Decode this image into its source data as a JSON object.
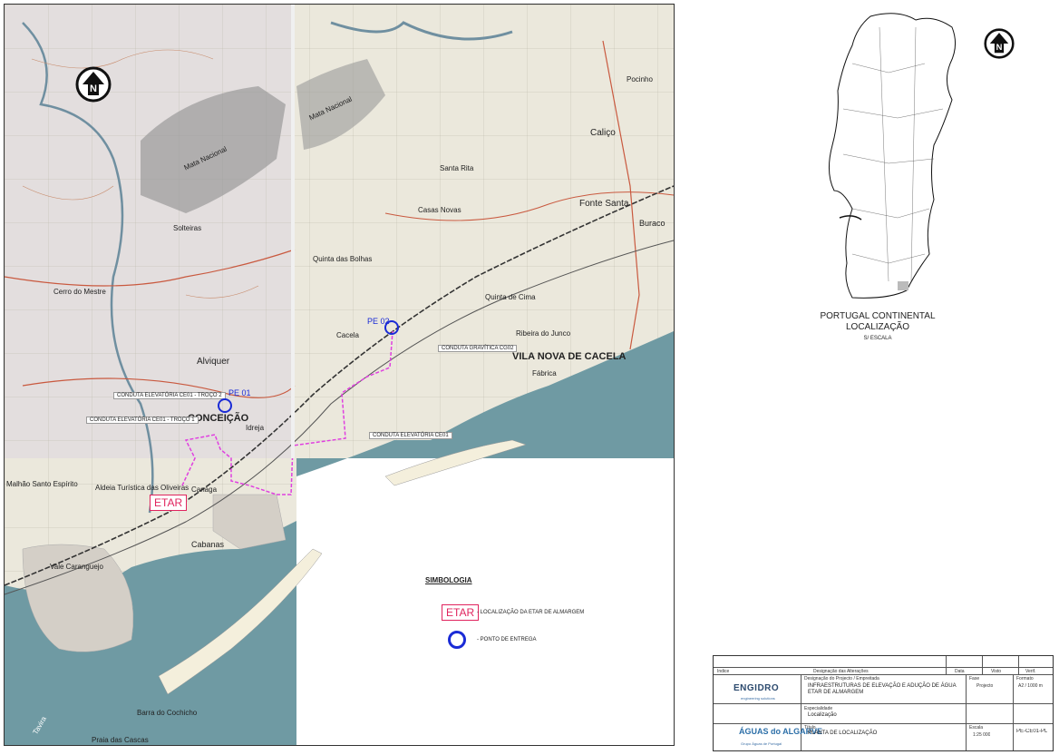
{
  "map": {
    "places": [
      {
        "id": "concei",
        "text": "CONCEIÇÃO",
        "big": true
      },
      {
        "id": "idreja",
        "text": "Idreja"
      },
      {
        "id": "alviq",
        "text": "Alviquer"
      },
      {
        "id": "vnc",
        "text": "VILA NOVA DE CACELA",
        "big": true
      },
      {
        "id": "cabanas",
        "text": "Cabanas"
      },
      {
        "id": "cacela",
        "text": "Cacela"
      },
      {
        "id": "santarita",
        "text": "Santa Rita"
      },
      {
        "id": "calico",
        "text": "Caliço"
      },
      {
        "id": "pocinho",
        "text": "Pocinho"
      },
      {
        "id": "fontesanta",
        "text": "Fonte Santa"
      },
      {
        "id": "buraco",
        "text": "Buraco"
      },
      {
        "id": "solteiras",
        "text": "Solteiras"
      },
      {
        "id": "malhasanto",
        "text": "Malhão Santo Espírito"
      },
      {
        "id": "aldeiatur",
        "text": "Aldeia Turística das Oliveiras"
      },
      {
        "id": "canaga",
        "text": "Canaga"
      },
      {
        "id": "valecaranguejo",
        "text": "Vale Caranguejo"
      },
      {
        "id": "matanac1",
        "text": "Mata Nacional"
      },
      {
        "id": "matanac2",
        "text": "Mata Nacional"
      },
      {
        "id": "quintacima",
        "text": "Quinta de Cima"
      },
      {
        "id": "ribeiraj",
        "text": "Ribeira do Junco"
      },
      {
        "id": "fabrica",
        "text": "Fábrica"
      },
      {
        "id": "lacaminho",
        "text": "Cerro do Mestre"
      },
      {
        "id": "casasnovas",
        "text": "Casas Novas"
      },
      {
        "id": "quintabolas",
        "text": "Quinta das Bolhas"
      },
      {
        "id": "barracochicho",
        "text": "Barra do Cochicho"
      },
      {
        "id": "praiacascas",
        "text": "Praia das Cascas"
      },
      {
        "id": "tavira",
        "text": "Tavira"
      }
    ],
    "conduits": [
      {
        "id": "c1",
        "text": "CONDUTA ELEVATÓRIA CE01 - TROÇO 2"
      },
      {
        "id": "c2",
        "text": "CONDUTA ELEVATÓRIA CE01 - TROÇO 1"
      },
      {
        "id": "c3",
        "text": "CONDUTA GRAVÍTICA CG02"
      },
      {
        "id": "c4",
        "text": "CONDUTA ELEVATÓRIA CE01"
      }
    ],
    "delivery_points": [
      {
        "id": "pe01",
        "label": "PE 01"
      },
      {
        "id": "pe02",
        "label": "PE 02"
      }
    ],
    "etar_label": "ETAR",
    "north_symbol": "north-arrow-icon",
    "colors": {
      "pipeline": "#e040e0",
      "delivery": "#1a2bd6",
      "etar": "#e0245e",
      "sea": "#6f9aa3",
      "land": "#e9e6d9"
    }
  },
  "inset": {
    "title": "PORTUGAL CONTINENTAL",
    "subtitle": "LOCALIZAÇÃO",
    "scale": "S/ ESCALA"
  },
  "legend": {
    "title": "SIMBOLOGIA",
    "items": [
      {
        "symbol": "ETAR",
        "text": "- LOCALIZAÇÃO DA ETAR DE ALMARGEM"
      },
      {
        "symbol": "circle",
        "text": "- PONTO DE ENTREGA"
      }
    ]
  },
  "titleblock": {
    "header": [
      "Índice",
      "Designação das Alterações",
      "Data",
      "Visto",
      "Verif."
    ],
    "company": "ENGIDRO",
    "company_sub": "engineering solutions",
    "client": "ÁGUAS do ALGARVE",
    "client_sub": "Grupo Águas de Portugal",
    "project_label": "Designação do Projecto / Empreitada",
    "project_title": "INFRAESTRUTURAS DE ELEVAÇÃO E ADUÇÃO DE ÁGUA ETAR DE ALMARGEM",
    "specialty_label": "Especialidade",
    "specialty": "Localização",
    "drawing_label": "Título",
    "drawing_title": "PLANTA DE LOCALIZAÇÃO",
    "phase_label": "Fase",
    "phase": "Projecto",
    "format_label": "Formato",
    "format": "A2 / 1000 m",
    "scale_label": "Escala",
    "scale": "1:25 000",
    "drawing_no": "PE-CE01-PL"
  }
}
